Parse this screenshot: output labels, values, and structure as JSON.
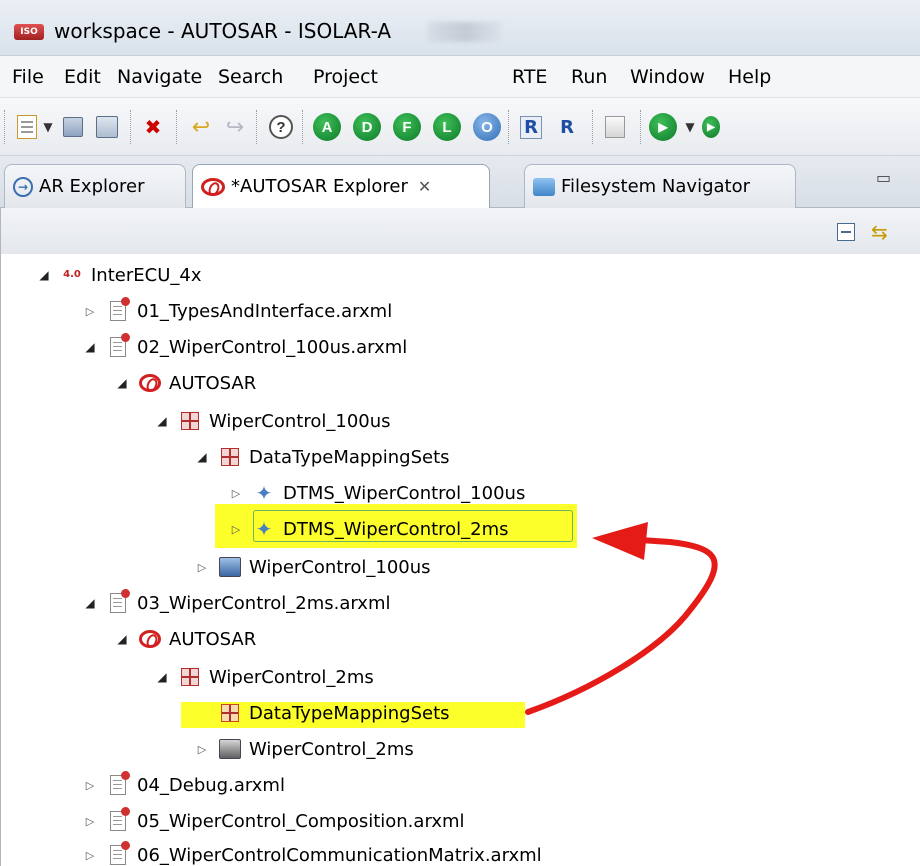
{
  "window": {
    "app_icon_label": "ISO",
    "title": "workspace - AUTOSAR - ISOLAR-A"
  },
  "menubar": {
    "items": [
      "File",
      "Edit",
      "Navigate",
      "Search",
      "Project",
      "RTE",
      "Run",
      "Window",
      "Help"
    ]
  },
  "toolbar": {
    "buttons": [
      {
        "icon": "new-wizard-icon"
      },
      {
        "icon": "save-icon"
      },
      {
        "icon": "save-all-icon"
      },
      {
        "icon": "delete-icon"
      },
      {
        "icon": "undo-icon"
      },
      {
        "icon": "redo-icon"
      },
      {
        "icon": "help-icon",
        "label": "?"
      },
      {
        "icon": "a-circle-icon",
        "label": "A"
      },
      {
        "icon": "d-circle-icon",
        "label": "D"
      },
      {
        "icon": "f-circle-icon",
        "label": "F"
      },
      {
        "icon": "l-circle-icon",
        "label": "L"
      },
      {
        "icon": "o-circle-icon",
        "label": "O"
      },
      {
        "icon": "rte-report-icon",
        "label": "R"
      },
      {
        "icon": "rte-icon",
        "label": "R"
      },
      {
        "icon": "build-icon"
      },
      {
        "icon": "run-icon"
      }
    ]
  },
  "tabs": [
    {
      "label": "AR Explorer",
      "icon": "arrow-right-circle-icon"
    },
    {
      "label": "*AUTOSAR Explorer",
      "icon": "autosar-logo-icon",
      "active": true
    },
    {
      "label": "Filesystem Navigator",
      "icon": "filesystem-icon"
    }
  ],
  "view_toolbar": {
    "collapse_all": "collapse-all-icon",
    "link_with_editor": "link-editor-icon"
  },
  "tree": [
    {
      "label": "InterECU_4x",
      "icon_text": "4.0",
      "type": "project",
      "expanded": true,
      "level": 0
    },
    {
      "label": "01_TypesAndInterface.arxml",
      "type": "file",
      "expanded": false,
      "level": 1
    },
    {
      "label": "02_WiperControl_100us.arxml",
      "type": "file",
      "expanded": true,
      "level": 1
    },
    {
      "label": "AUTOSAR",
      "type": "autosar",
      "expanded": true,
      "level": 2
    },
    {
      "label": "WiperControl_100us",
      "type": "package",
      "expanded": true,
      "level": 3
    },
    {
      "label": "DataTypeMappingSets",
      "type": "package",
      "expanded": true,
      "level": 4
    },
    {
      "label": "DTMS_WiperControl_100us",
      "type": "dtms",
      "expanded": false,
      "level": 5
    },
    {
      "label": "DTMS_WiperControl_2ms",
      "type": "dtms",
      "expanded": false,
      "level": 5,
      "highlighted": true,
      "selected": true
    },
    {
      "label": "WiperControl_100us",
      "type": "component",
      "expanded": false,
      "level": 4
    },
    {
      "label": "03_WiperControl_2ms.arxml",
      "type": "file",
      "expanded": true,
      "level": 1
    },
    {
      "label": "AUTOSAR",
      "type": "autosar",
      "expanded": true,
      "level": 2
    },
    {
      "label": "WiperControl_2ms",
      "type": "package",
      "expanded": true,
      "level": 3
    },
    {
      "label": "DataTypeMappingSets",
      "type": "package-orange",
      "expanded": null,
      "level": 4,
      "highlighted": true
    },
    {
      "label": "WiperControl_2ms",
      "type": "component-dark",
      "expanded": false,
      "level": 4
    },
    {
      "label": "04_Debug.arxml",
      "type": "file",
      "expanded": false,
      "level": 1
    },
    {
      "label": "05_WiperControl_Composition.arxml",
      "type": "file",
      "expanded": false,
      "level": 1
    },
    {
      "label": "06_WiperControlCommunicationMatrix.arxml",
      "type": "file",
      "expanded": false,
      "level": 1
    }
  ],
  "colors": {
    "highlight": "#fcff2a",
    "annotation_arrow": "#e41b17",
    "selection_border": "#6fb25f"
  }
}
